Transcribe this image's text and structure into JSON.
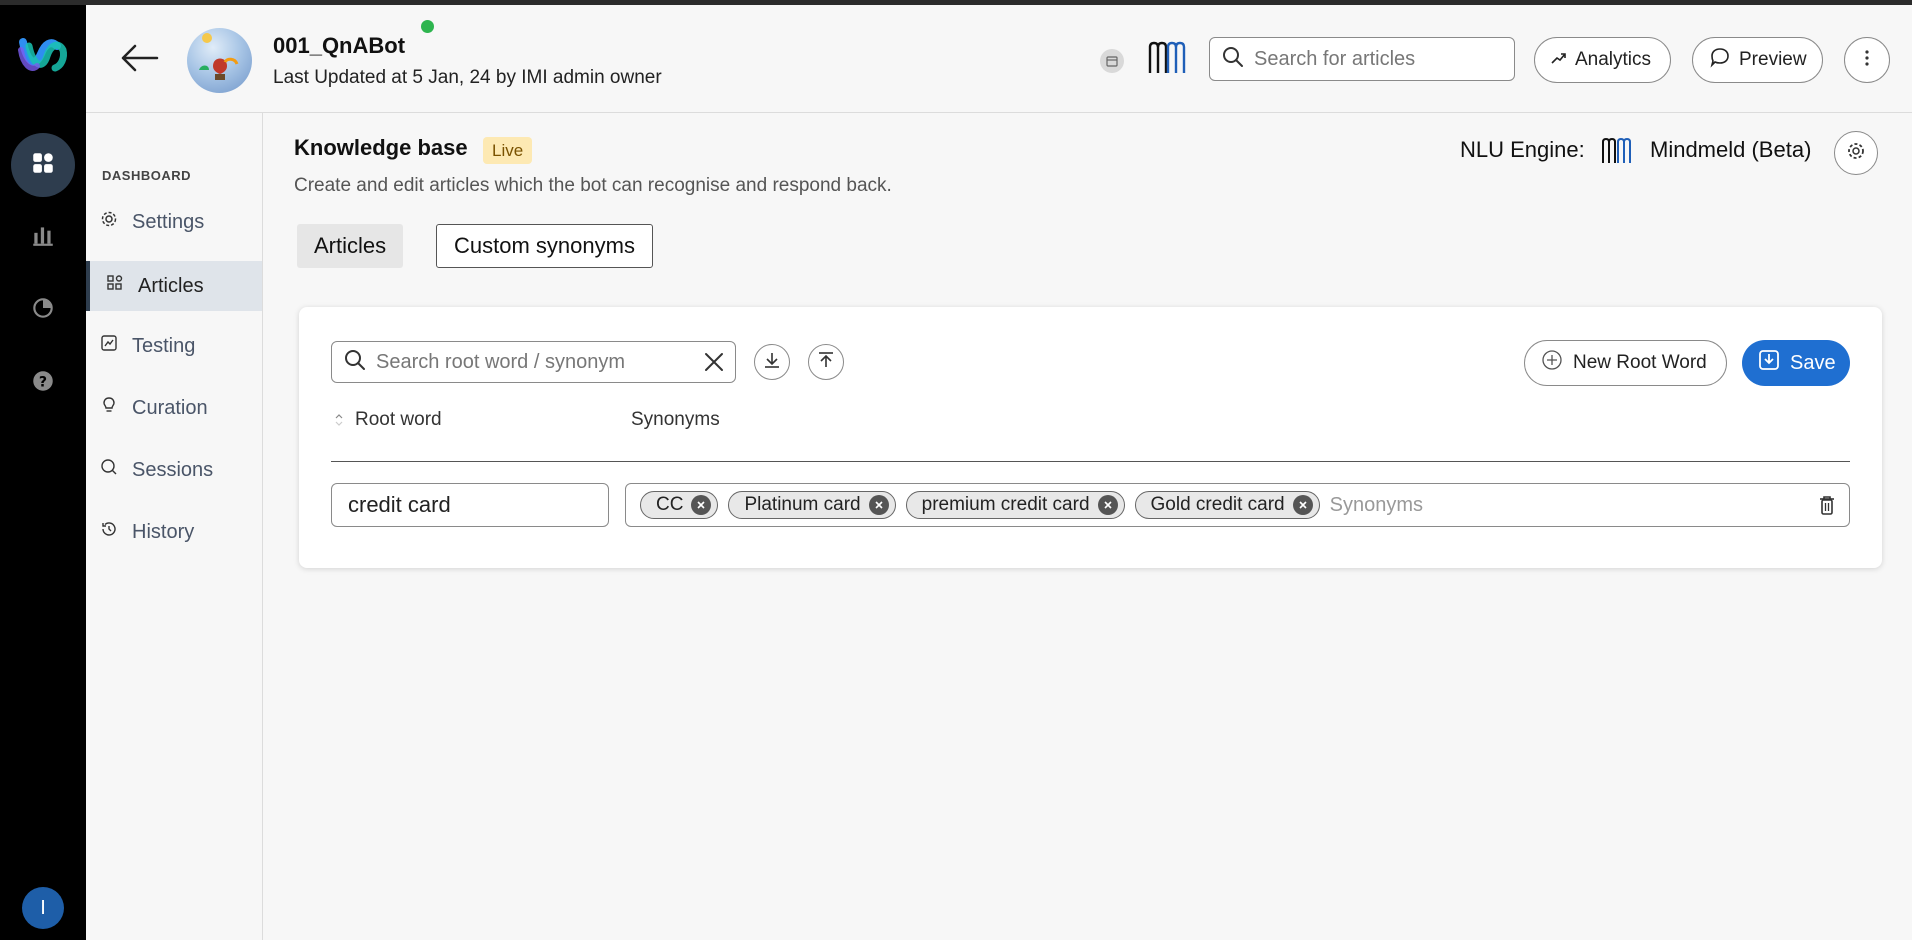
{
  "header": {
    "bot_name": "001_QnABot",
    "last_updated": "Last Updated at 5 Jan, 24 by IMI admin owner",
    "search_placeholder": "Search for articles",
    "analytics_label": "Analytics",
    "preview_label": "Preview"
  },
  "rail": {
    "icons": [
      "dashboard-icon",
      "bar-chart-icon",
      "pie-chart-icon",
      "help-icon"
    ],
    "user_initial": "I"
  },
  "subnav": {
    "section_label": "DASHBOARD",
    "items": [
      {
        "label": "Settings",
        "icon": "gear-icon",
        "active": false
      },
      {
        "label": "Articles",
        "icon": "articles-icon",
        "active": true
      },
      {
        "label": "Testing",
        "icon": "testing-icon",
        "active": false
      },
      {
        "label": "Curation",
        "icon": "bulb-icon",
        "active": false
      },
      {
        "label": "Sessions",
        "icon": "chat-search-icon",
        "active": false
      },
      {
        "label": "History",
        "icon": "history-icon",
        "active": false
      }
    ]
  },
  "main": {
    "title": "Knowledge base",
    "status_badge": "Live",
    "description": "Create and edit articles which the bot can recognise and respond back.",
    "nlu_label": "NLU Engine:",
    "nlu_value": "Mindmeld (Beta)",
    "tabs": [
      {
        "label": "Articles",
        "selected": false
      },
      {
        "label": "Custom synonyms",
        "selected": true
      }
    ]
  },
  "synonyms_card": {
    "search_placeholder": "Search root word / synonym",
    "new_root_label": "New Root Word",
    "save_label": "Save",
    "columns": {
      "root": "Root word",
      "synonyms": "Synonyms"
    },
    "rows": [
      {
        "root_word": "credit card",
        "synonyms": [
          "CC",
          "Platinum card",
          "premium credit card",
          "Gold credit card"
        ],
        "synonym_placeholder": "Synonyms"
      }
    ]
  },
  "colors": {
    "accent": "#1f6fd1",
    "rail_bg": "#000000",
    "rail_active": "#2e3d4e",
    "online": "#2eb54f",
    "live_badge_bg": "#fde9b3"
  }
}
